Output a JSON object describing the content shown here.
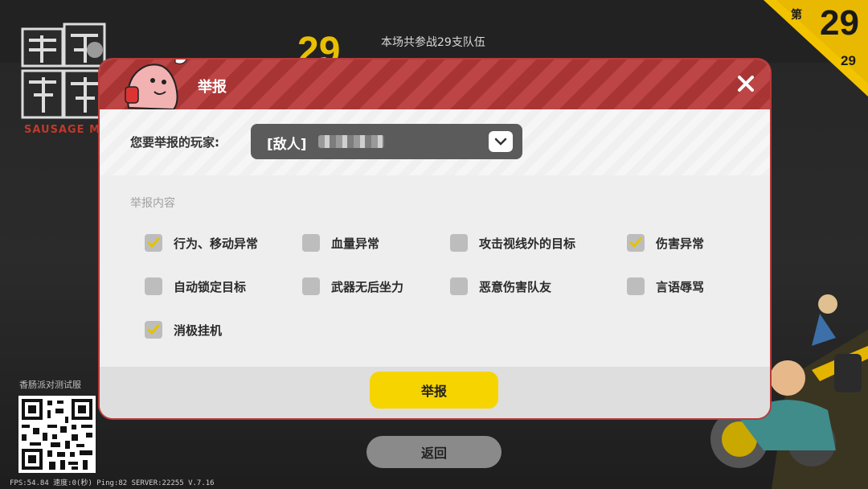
{
  "background": {
    "rank": {
      "prefix": "第",
      "number": "29",
      "total": "29"
    },
    "header_big_number": "29",
    "header_teams": "本场共参战29支队伍",
    "logo_subtitle": "SAUSAGE MA",
    "test_server_label": "香肠派对测试服",
    "fps_line": "FPS:54.84 速度:0(秒) Ping:82 SERVER:22255 V.7.16",
    "back_button": "返回"
  },
  "dialog": {
    "title": "举报",
    "close_icon": "close-icon",
    "player_label": "您要举报的玩家:",
    "player_value": "[敌人]",
    "section_label": "举报内容",
    "options": [
      {
        "label": "行为、移动异常",
        "checked": true
      },
      {
        "label": "血量异常",
        "checked": false
      },
      {
        "label": "攻击视线外的目标",
        "checked": false
      },
      {
        "label": "伤害异常",
        "checked": true
      },
      {
        "label": "自动锁定目标",
        "checked": false
      },
      {
        "label": "武器无后坐力",
        "checked": false
      },
      {
        "label": "恶意伤害队友",
        "checked": false
      },
      {
        "label": "言语辱骂",
        "checked": false
      },
      {
        "label": "消极挂机",
        "checked": true
      }
    ],
    "submit_button": "举报"
  },
  "colors": {
    "header_red": "#b03a3a",
    "accent_yellow": "#f6d400",
    "checkbox_gray": "#bdbdbd",
    "check_mark_yellow": "#e6c200"
  }
}
